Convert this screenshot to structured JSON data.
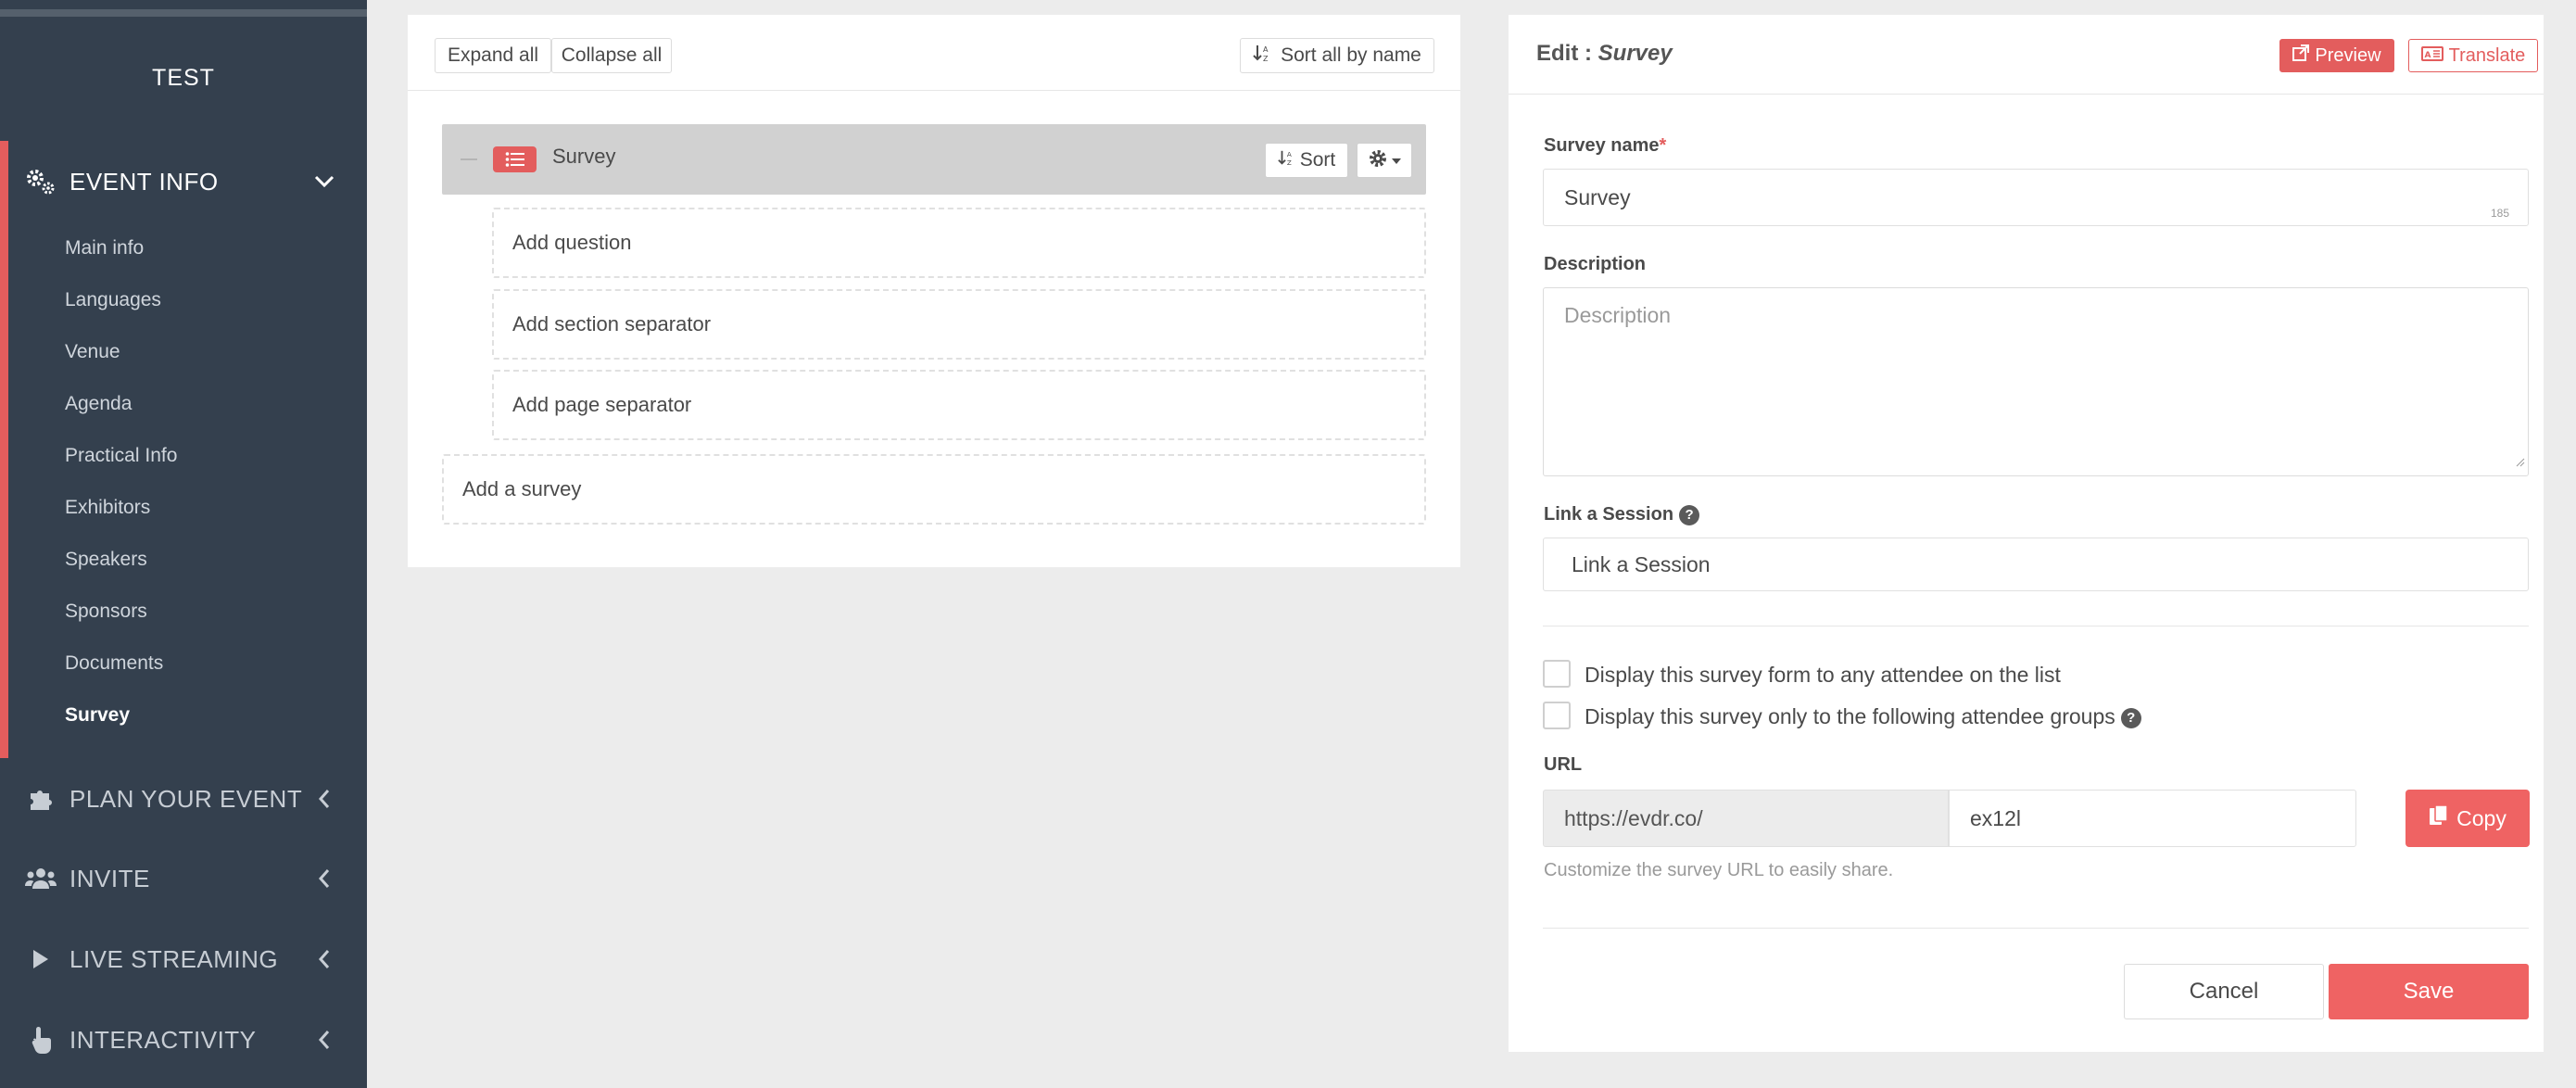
{
  "sidebar": {
    "brand": "TEST",
    "event_info": {
      "label": "EVENT INFO",
      "items": [
        {
          "label": "Main info"
        },
        {
          "label": "Languages"
        },
        {
          "label": "Venue"
        },
        {
          "label": "Agenda"
        },
        {
          "label": "Practical Info"
        },
        {
          "label": "Exhibitors"
        },
        {
          "label": "Speakers"
        },
        {
          "label": "Sponsors"
        },
        {
          "label": "Documents"
        },
        {
          "label": "Survey"
        }
      ],
      "active_item": "Survey"
    },
    "plan": {
      "label": "PLAN YOUR EVENT"
    },
    "invite": {
      "label": "INVITE"
    },
    "live": {
      "label": "LIVE STREAMING"
    },
    "interactivity": {
      "label": "INTERACTIVITY"
    }
  },
  "middle": {
    "expand_all": "Expand all",
    "collapse_all": "Collapse all",
    "sort_all": "Sort all by name",
    "survey_title": "Survey",
    "sort_label": "Sort",
    "add_question": "Add question",
    "add_section_separator": "Add section separator",
    "add_page_separator": "Add page separator",
    "add_survey": "Add a survey"
  },
  "editor": {
    "title_prefix": "Edit : ",
    "title_name": "Survey",
    "preview": "Preview",
    "translate": "Translate",
    "survey_name_label": "Survey name",
    "required_mark": "*",
    "survey_name_value": "Survey",
    "survey_name_counter": "185",
    "description_label": "Description",
    "description_placeholder": "Description",
    "link_session_label": "Link a Session",
    "link_session_placeholder": "Link a Session",
    "display_any_label": "Display this survey form to any attendee on the list",
    "display_groups_label": "Display this survey only to the following attendee groups",
    "url_label": "URL",
    "url_prefix": "https://evdr.co/",
    "url_slug": "ex12l",
    "copy": "Copy",
    "url_help": "Customize the survey URL to easily share.",
    "cancel": "Cancel",
    "save": "Save"
  },
  "colors": {
    "accent": "#e35d5d",
    "sidebar_bg": "#34404e",
    "page_bg": "#ececec"
  },
  "icons": {
    "event_info": "cogs-icon",
    "plan": "puzzle-icon",
    "invite": "users-icon",
    "live": "play-icon",
    "interactivity": "hand-pointer-icon"
  }
}
